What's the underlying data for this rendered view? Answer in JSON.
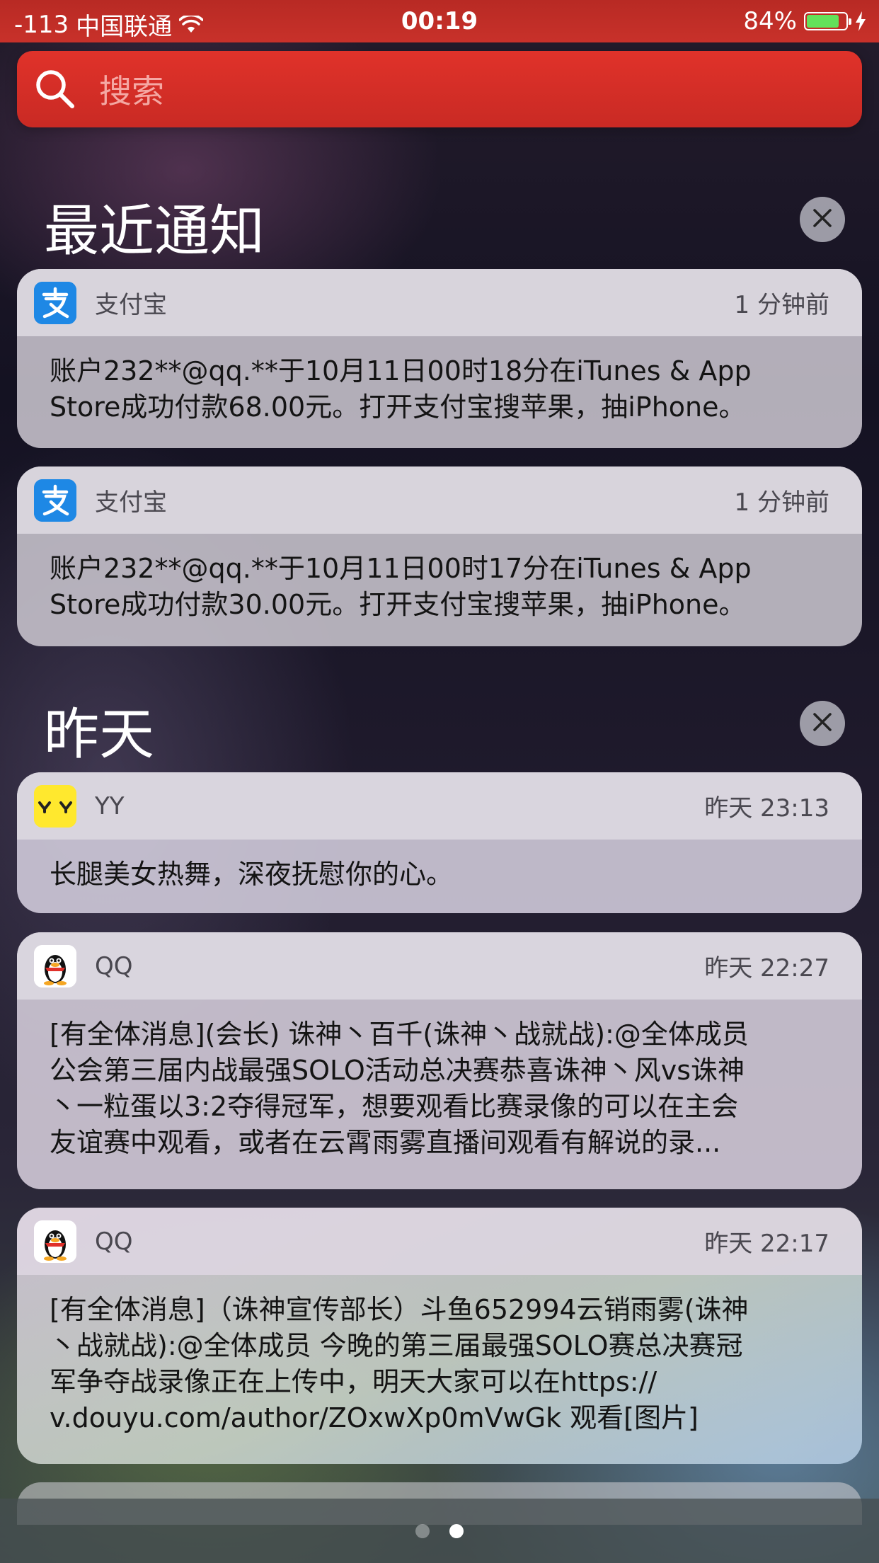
{
  "status_bar": {
    "signal": "-113",
    "carrier": "中国联通",
    "time": "00:19",
    "battery_percent": "84%",
    "battery_level": 0.84
  },
  "search": {
    "placeholder": "搜索"
  },
  "sections": [
    {
      "title": "最近通知",
      "notifications": [
        {
          "app": "支付宝",
          "icon": "alipay-icon",
          "time": "1 分钟前",
          "body": "账户232**@qq.**于10月11日00时18分在iTunes & App\nStore成功付款68.00元。打开支付宝搜苹果，抽iPhone。"
        },
        {
          "app": "支付宝",
          "icon": "alipay-icon",
          "time": "1 分钟前",
          "body": "账户232**@qq.**于10月11日00时17分在iTunes & App\nStore成功付款30.00元。打开支付宝搜苹果，抽iPhone。"
        }
      ]
    },
    {
      "title": "昨天",
      "notifications": [
        {
          "app": "YY",
          "icon": "yy-icon",
          "time": "昨天 23:13",
          "body": "长腿美女热舞，深夜抚慰你的心。"
        },
        {
          "app": "QQ",
          "icon": "qq-penguin-icon",
          "time": "昨天 22:27",
          "body": "[有全体消息](会长) 诛神丶百千(诛神丶战就战):@全体成员\n公会第三届内战最强SOLO活动总决赛恭喜诛神丶风vs诛神\n丶一粒蛋以3:2夺得冠军，想要观看比赛录像的可以在主会\n友谊赛中观看，或者在云霄雨雾直播间观看有解说的录..."
        },
        {
          "app": "QQ",
          "icon": "qq-penguin-icon",
          "time": "昨天 22:17",
          "body": "[有全体消息]（诛神宣传部长）斗鱼652994云销雨雾(诛神\n丶战就战):@全体成员 今晚的第三届最强SOLO赛总决赛冠\n军争夺战录像正在上传中，明天大家可以在https://\nv.douyu.com/author/ZOxwXp0mVwGk 观看[图片]"
        }
      ]
    }
  ],
  "page_indicator": {
    "count": 2,
    "active": 2
  },
  "colors": {
    "search_bar": "#d42e27",
    "status_bar": "#c02d27",
    "alipay_blue": "#1e88e5",
    "yy_yellow": "#ffe82e"
  }
}
